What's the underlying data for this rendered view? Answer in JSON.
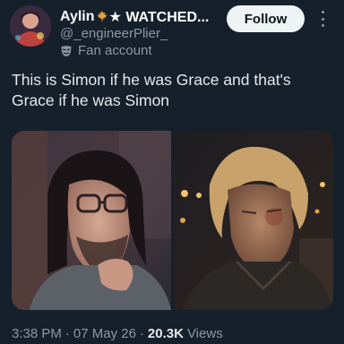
{
  "author": {
    "display_name": "Aylin",
    "name_suffix": "★ WATCHED...",
    "handle": "@_engineerPlier_",
    "account_label": "Fan account",
    "name_emoji_icon": "maple-leaf-icon",
    "account_badge_icon": "mask-icon"
  },
  "actions": {
    "follow_label": "Follow",
    "more_icon": "more-vertical-icon"
  },
  "post": {
    "text": "This is Simon if he was Grace and that's Grace if he was Simon"
  },
  "media": {
    "images": [
      {
        "name": "photo-left-man-glasses"
      },
      {
        "name": "photo-right-man-blond"
      }
    ]
  },
  "meta": {
    "time": "3:38 PM",
    "separator": "·",
    "date": "07 May 26",
    "views_count": "20.3K",
    "views_label": "Views"
  },
  "colors": {
    "background": "#15202b",
    "secondary_text": "#8b98a5",
    "follow_button_bg": "#eff3f4"
  }
}
